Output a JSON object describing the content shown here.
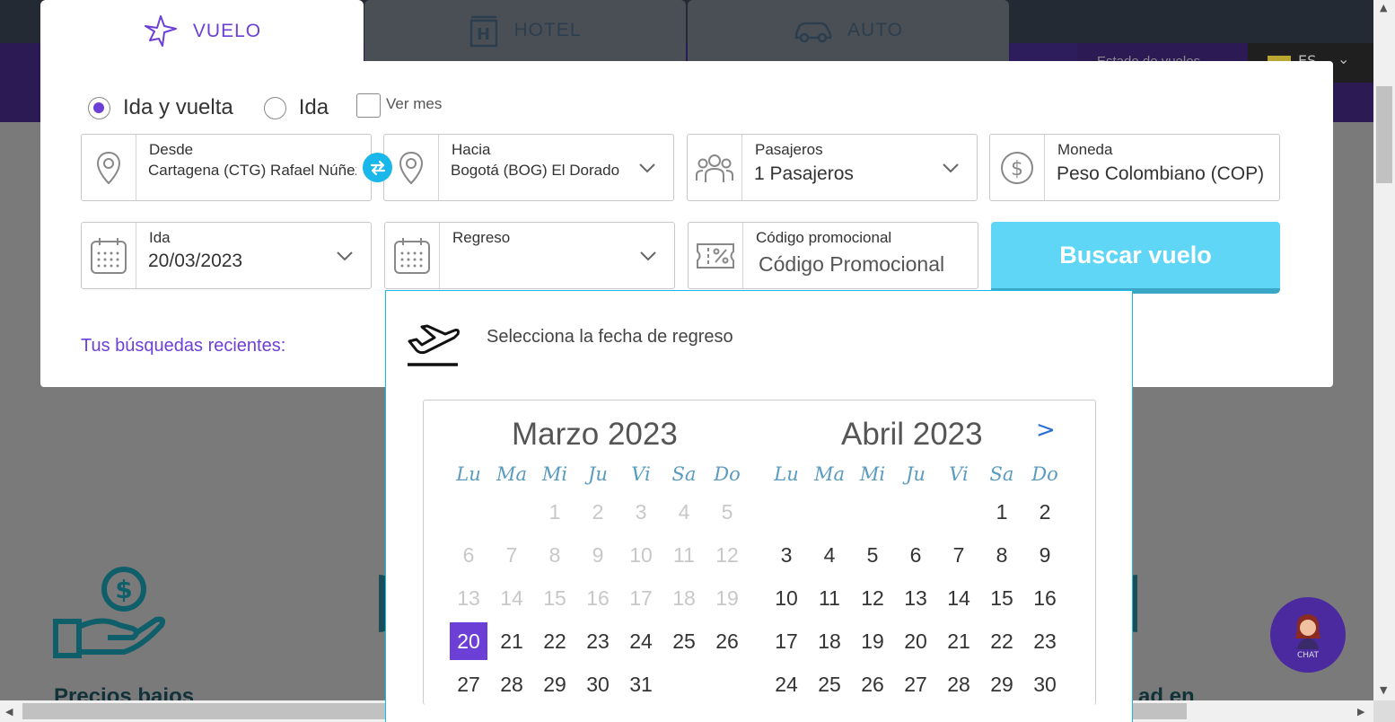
{
  "background": {
    "nav_status": "Estado de vuelos",
    "lang": "ES",
    "feature_title_left": "Precios bajos",
    "feature_title_right": "ad en"
  },
  "tabs": [
    {
      "label": "VUELO",
      "icon": "plane-icon"
    },
    {
      "label": "HOTEL",
      "icon": "hotel-icon"
    },
    {
      "label": "AUTO",
      "icon": "car-icon"
    }
  ],
  "trip_type": {
    "round_trip": "Ida y vuelta",
    "one_way": "Ida",
    "see_month": "Ver mes"
  },
  "fields": {
    "from": {
      "label": "Desde",
      "value": "Cartagena (CTG) Rafael Núñez"
    },
    "to": {
      "label": "Hacia",
      "value": "Bogotá (BOG) El Dorado"
    },
    "passengers": {
      "label": "Pasajeros",
      "value": "1 Pasajeros"
    },
    "currency": {
      "label": "Moneda",
      "value": "Peso Colombiano (COP)"
    },
    "departure": {
      "label": "Ida",
      "value": "20/03/2023"
    },
    "return": {
      "label": "Regreso",
      "value": ""
    },
    "promo": {
      "label": "Código promocional",
      "placeholder": "Código Promocional"
    }
  },
  "search_button": "Buscar vuelo",
  "recent_searches": "Tus búsquedas recientes:",
  "datepicker": {
    "heading": "Selecciona la fecha de regreso",
    "next": ">",
    "weekdays": [
      "Lu",
      "Ma",
      "Mi",
      "Ju",
      "Vi",
      "Sa",
      "Do"
    ],
    "months": [
      {
        "title": "Marzo 2023",
        "first_weekday": 2,
        "days_shown": 31,
        "disabled_through": 19,
        "selected": 20
      },
      {
        "title": "Abril 2023",
        "first_weekday": 5,
        "days_shown": 30,
        "disabled_through": 0,
        "selected": null
      }
    ]
  },
  "chat": {
    "label": "CHAT"
  },
  "colors": {
    "accent": "#6c3fd6",
    "button": "#5fd6f6",
    "link": "#1ab7ea"
  }
}
